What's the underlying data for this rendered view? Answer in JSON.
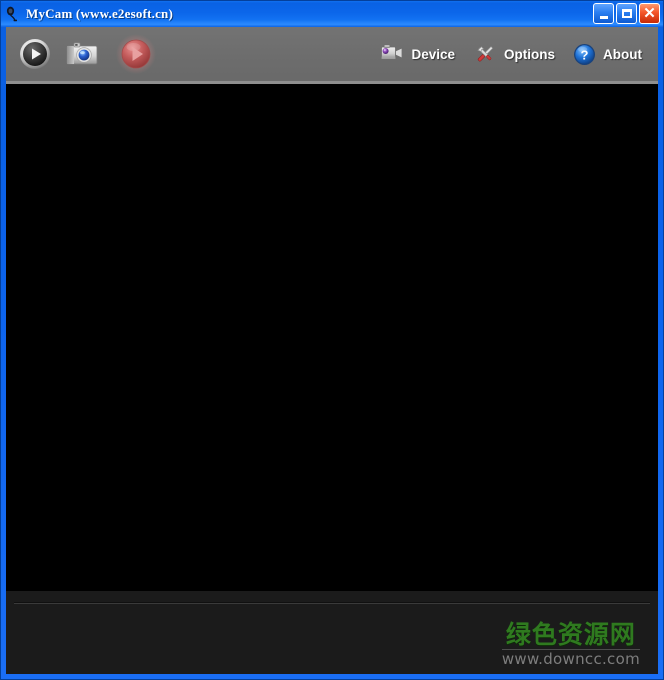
{
  "window": {
    "title": "MyCam (www.e2esoft.cn)",
    "icon": "webcam-icon",
    "frame_color": "#0b63ec",
    "controls": [
      {
        "name": "minimize",
        "label": "_",
        "tooltip": "Minimize"
      },
      {
        "name": "maximize",
        "label": "□",
        "tooltip": "Maximize"
      },
      {
        "name": "close",
        "label": "✕",
        "tooltip": "Close"
      }
    ]
  },
  "toolbar": {
    "background_color": "#6e6e6e",
    "buttons": [
      {
        "name": "preview-play-button",
        "icon": "play-circle-icon",
        "label": "",
        "style": "silver"
      },
      {
        "name": "snapshot-button",
        "icon": "camera-icon",
        "label": "",
        "style": "camera"
      },
      {
        "name": "record-button",
        "icon": "record-play-icon",
        "label": "",
        "style": "red"
      }
    ],
    "menu": [
      {
        "name": "device-menu",
        "icon": "camcorder-icon",
        "label": "Device"
      },
      {
        "name": "options-menu",
        "icon": "tools-icon",
        "label": "Options"
      },
      {
        "name": "about-menu",
        "icon": "question-circle-icon",
        "label": "About"
      }
    ]
  },
  "video": {
    "background_color": "#000000",
    "status_text": ""
  },
  "bottom_panel": {
    "background_color": "#1b1b1b",
    "watermark": {
      "text_cn": "绿色资源网",
      "url": "www.downcc.com",
      "color_cn": "#2f7a1f",
      "color_url": "#7d7d7d"
    }
  }
}
